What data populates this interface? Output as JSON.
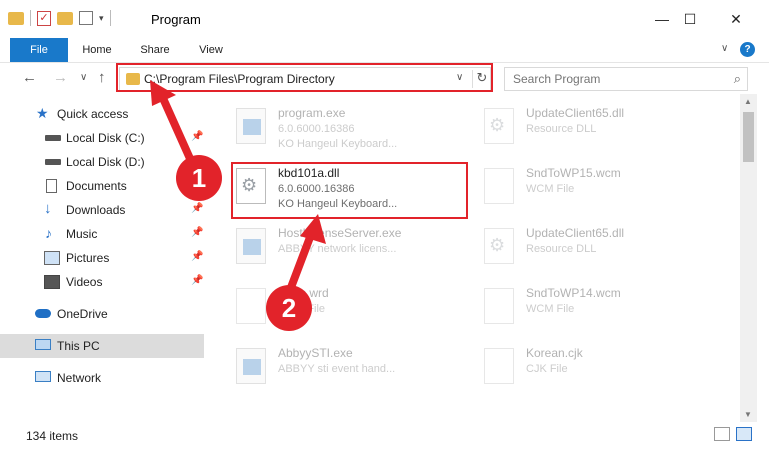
{
  "window": {
    "title": "Program",
    "controls": {
      "minimize": "—",
      "maximize": "☐",
      "close": "✕"
    }
  },
  "ribbon": {
    "tabs": [
      "File",
      "Home",
      "Share",
      "View"
    ],
    "help": "?"
  },
  "address": {
    "path": "C:\\Program Files\\Program Directory"
  },
  "search": {
    "placeholder": "Search Program"
  },
  "sidebar": {
    "items": [
      {
        "label": "Quick access",
        "icon": "star-icon"
      },
      {
        "label": "Local Disk (C:)",
        "icon": "drive-icon",
        "pinned": true
      },
      {
        "label": "Local Disk (D:)",
        "icon": "drive-icon",
        "pinned": true
      },
      {
        "label": "Documents",
        "icon": "documents-icon",
        "pinned": true
      },
      {
        "label": "Downloads",
        "icon": "download-icon",
        "pinned": true
      },
      {
        "label": "Music",
        "icon": "music-icon",
        "pinned": true
      },
      {
        "label": "Pictures",
        "icon": "pictures-icon",
        "pinned": true
      },
      {
        "label": "Videos",
        "icon": "videos-icon",
        "pinned": true
      },
      {
        "label": "OneDrive",
        "icon": "cloud-icon"
      },
      {
        "label": "This PC",
        "icon": "computer-icon",
        "selected": true
      },
      {
        "label": "Network",
        "icon": "network-icon"
      }
    ]
  },
  "files": [
    {
      "name": "program.exe",
      "line2": "6.0.6000.16386",
      "line3": "KO Hangeul Keyboard...",
      "type": "exe",
      "faded": true
    },
    {
      "name": "UpdateClient65.dll",
      "line2": "Resource DLL",
      "line3": "",
      "type": "dll",
      "faded": true
    },
    {
      "name": "kbd101a.dll",
      "line2": "6.0.6000.16386",
      "line3": "KO Hangeul Keyboard...",
      "type": "dll",
      "faded": false,
      "highlighted": true
    },
    {
      "name": "SndToWP15.wcm",
      "line2": "WCM File",
      "line3": "",
      "type": "file",
      "faded": true
    },
    {
      "name": "HostLicenseServer.exe",
      "line2": "ABBYY network licens...",
      "line3": "",
      "type": "exe",
      "faded": true
    },
    {
      "name": "UpdateClient65.dll",
      "line2": "Resource DLL",
      "line3": "",
      "type": "dll",
      "faded": true
    },
    {
      "name": "basic.wrd",
      "line2": "WRD File",
      "line3": "",
      "type": "file",
      "faded": true
    },
    {
      "name": "SndToWP14.wcm",
      "line2": "WCM File",
      "line3": "",
      "type": "file",
      "faded": true
    },
    {
      "name": "AbbyySTI.exe",
      "line2": "ABBYY sti event hand...",
      "line3": "",
      "type": "exe",
      "faded": true
    },
    {
      "name": "Korean.cjk",
      "line2": "CJK File",
      "line3": "",
      "type": "file",
      "faded": true
    }
  ],
  "status": {
    "count": "134 items"
  },
  "steps": [
    "1",
    "2"
  ],
  "colors": {
    "accent": "#1979ca",
    "highlight": "#e2232a",
    "folder": "#e8b84a"
  }
}
